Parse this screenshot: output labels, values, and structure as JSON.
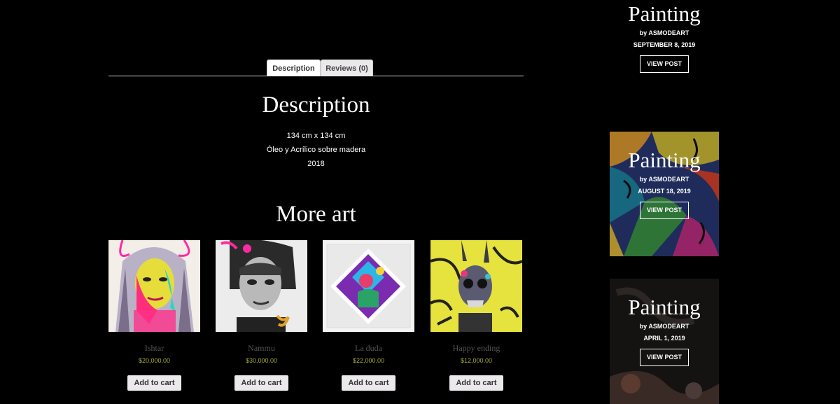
{
  "tabs": [
    {
      "label": "Description"
    },
    {
      "label": "Reviews (0)"
    }
  ],
  "description": {
    "title": "Description",
    "lines": [
      "134 cm x 134 cm",
      "Óleo y Acrílico sobre madera",
      "2018"
    ]
  },
  "more_art": {
    "title": "More art",
    "products": [
      {
        "name": "Ishtar",
        "price": "$20,000.00",
        "button": "Add to cart"
      },
      {
        "name": "Nammu",
        "price": "$30,000.00",
        "button": "Add to cart"
      },
      {
        "name": "La duda",
        "price": "$22,000.00",
        "button": "Add to cart"
      },
      {
        "name": "Happy ending",
        "price": "$12,000.00",
        "button": "Add to cart"
      }
    ]
  },
  "sidebar": {
    "posts": [
      {
        "title": "Painting",
        "byline": "by ASMODEART",
        "date": "SEPTEMBER 8, 2019",
        "button": "VIEW POST"
      },
      {
        "title": "Painting",
        "byline": "by ASMODEART",
        "date": "AUGUST 18, 2019",
        "button": "VIEW POST"
      },
      {
        "title": "Painting",
        "byline": "by ASMODEART",
        "date": "APRIL 1, 2019",
        "button": "VIEW POST"
      }
    ]
  },
  "colors": {
    "background": "#000000",
    "price": "#a2a93a",
    "product_name": "#555555",
    "button_bg": "#ebe9eb"
  }
}
